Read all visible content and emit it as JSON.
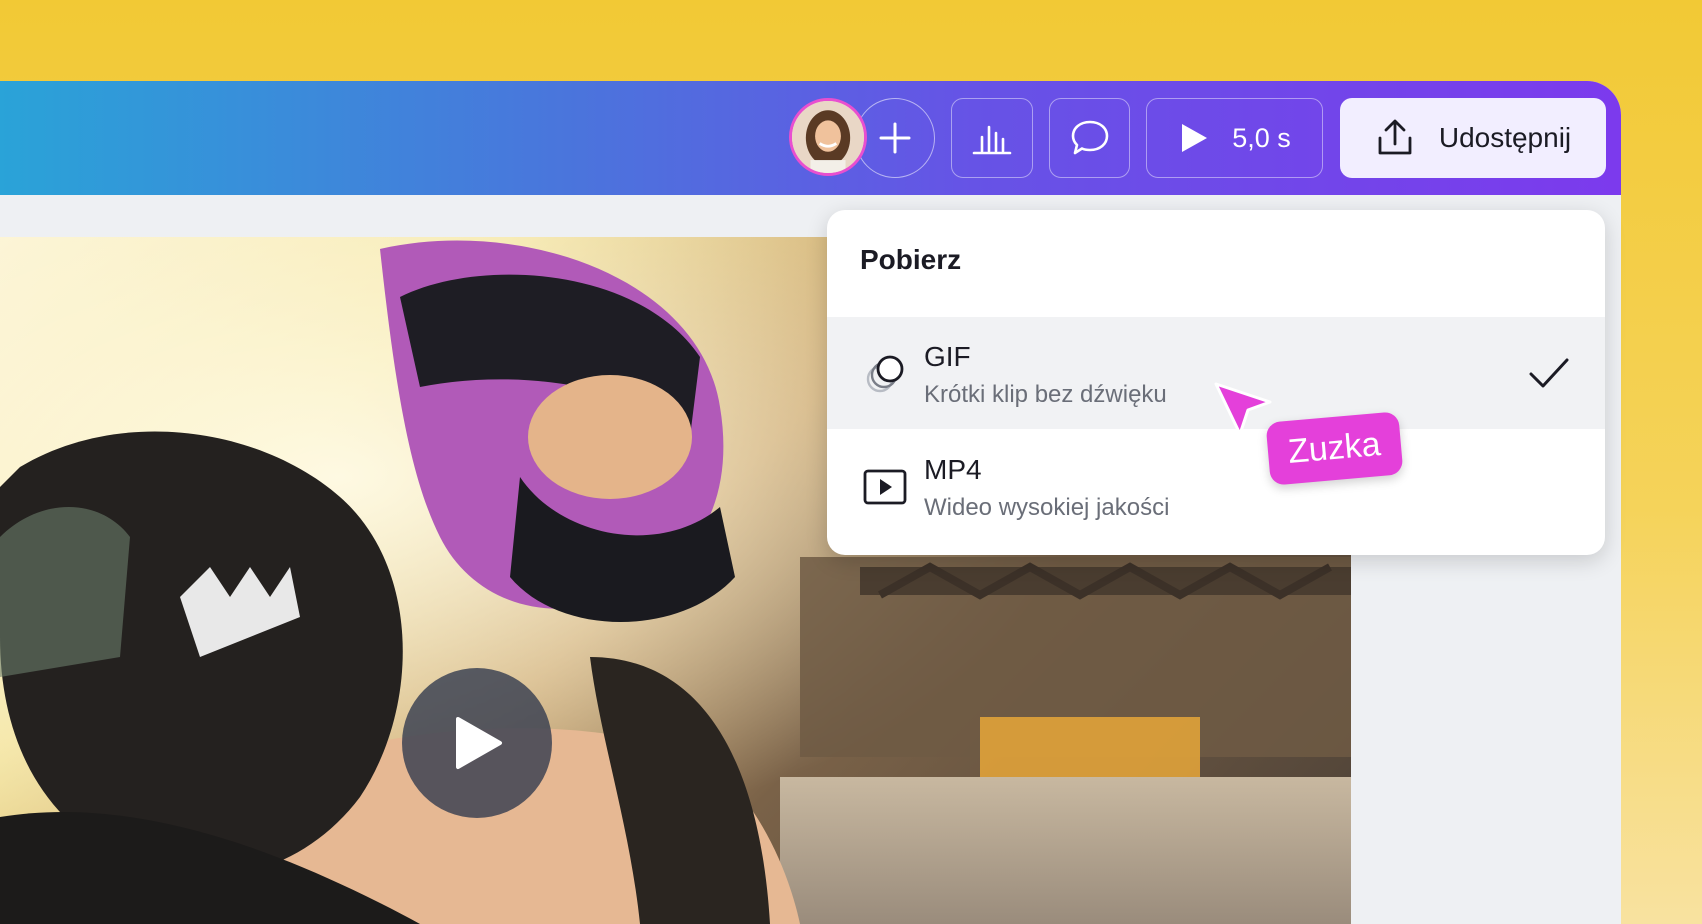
{
  "toolbar": {
    "add_icon": "plus-icon",
    "stats_icon": "bar-chart-icon",
    "comment_icon": "comment-icon",
    "play_icon": "play-icon",
    "duration": "5,0 s",
    "share_icon": "upload-icon",
    "share_label": "Udostępnij"
  },
  "download_menu": {
    "title": "Pobierz",
    "options": [
      {
        "title": "GIF",
        "subtitle": "Krótki klip bez dźwięku",
        "icon": "gif-circles-icon",
        "selected": true
      },
      {
        "title": "MP4",
        "subtitle": "Wideo wysokiej jakości",
        "icon": "video-play-icon",
        "selected": false
      }
    ]
  },
  "collaborator": {
    "name": "Zuzka",
    "color": "#e440da"
  },
  "colors": {
    "accent_purple": "#7c3aed",
    "accent_blue": "#2aa3d8",
    "background_yellow": "#f2c935"
  }
}
